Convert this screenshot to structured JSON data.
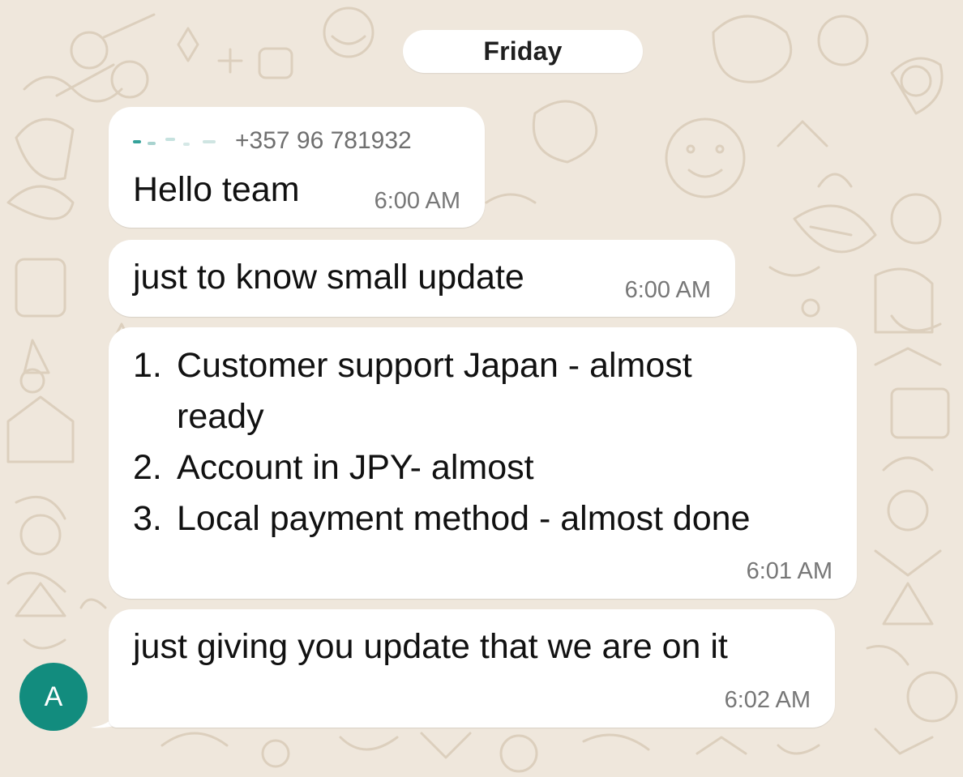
{
  "date_separator": "Friday",
  "avatar_initial": "A",
  "colors": {
    "background": "#efe7dc",
    "bubble": "#ffffff",
    "avatar": "#128c7e",
    "timestamp": "#777777"
  },
  "messages": [
    {
      "sender_phone": "+357 96 781932",
      "text": "Hello team",
      "time": "6:00 AM"
    },
    {
      "text": "just to know small update",
      "time": "6:00 AM"
    },
    {
      "items": [
        {
          "number": "1.",
          "text": "Customer support Japan - almost ready"
        },
        {
          "number": "2.",
          "text": "Account in JPY- almost"
        },
        {
          "number": "3.",
          "text": "Local payment method - almost done"
        }
      ],
      "time": "6:01 AM"
    },
    {
      "text": "just giving you update that we are on it",
      "time": "6:02 AM"
    }
  ]
}
